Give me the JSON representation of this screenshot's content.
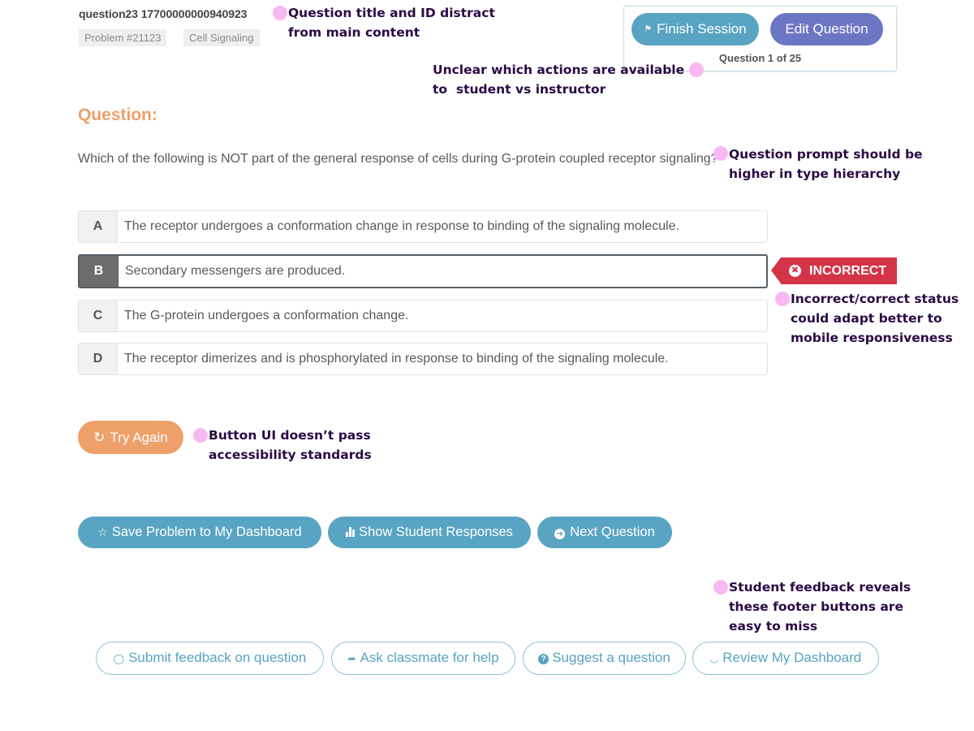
{
  "header": {
    "question_id": "question23 17700000000940923",
    "tags": [
      "Problem #21123",
      "Cell Signaling"
    ]
  },
  "session_panel": {
    "finish_label": "Finish Session",
    "finish_icon": "flag-icon",
    "edit_label": "Edit Question",
    "progress_text": "Question 1 of 25"
  },
  "question": {
    "heading": "Question:",
    "prompt": "Which of the following is NOT part of the general response of cells during G-protein coupled receptor signaling?",
    "options": [
      {
        "letter": "A",
        "text": "The receptor undergoes a conformation change in response to binding of the signaling molecule.",
        "selected": false
      },
      {
        "letter": "B",
        "text": "Secondary messengers are produced.",
        "selected": true
      },
      {
        "letter": "C",
        "text": "The G-protein undergoes a conformation change.",
        "selected": false
      },
      {
        "letter": "D",
        "text": "The receptor dimerizes and is phosphorylated in response to binding of the signaling molecule.",
        "selected": false
      }
    ],
    "status_label": "INCORRECT",
    "status_color": "#d33448"
  },
  "try_again": {
    "label": "Try Again",
    "icon": "refresh-icon",
    "color": "#eea06a"
  },
  "actions": {
    "save_label": "Save Problem to My Dashboard",
    "save_icon": "star-icon",
    "show_label": "Show Student Responses",
    "show_icon": "bar-chart-icon",
    "next_label": "Next Question",
    "next_icon": "arrow-circle-icon",
    "color": "#58a4c2"
  },
  "footer": {
    "feedback_label": "Submit feedback on question",
    "ask_label": "Ask classmate for help",
    "suggest_label": "Suggest a question",
    "review_label": "Review My Dashboard"
  },
  "annotations": {
    "title_note": [
      "Question title and ID distract",
      "from main content"
    ],
    "actions_note": [
      "Unclear which actions are available",
      "to  student vs instructor"
    ],
    "prompt_note": [
      "Question prompt should be",
      "higher in type hierarchy"
    ],
    "status_note": [
      "Incorrect/correct status",
      "could adapt better to",
      "mobile responsiveness"
    ],
    "button_note": [
      "Button UI doesn’t pass",
      "accessibility standards"
    ],
    "footer_note": [
      "Student feedback reveals",
      "these footer buttons are",
      "easy to miss"
    ],
    "dot_color": "#f8b8f2",
    "text_color": "#2a0a44"
  }
}
